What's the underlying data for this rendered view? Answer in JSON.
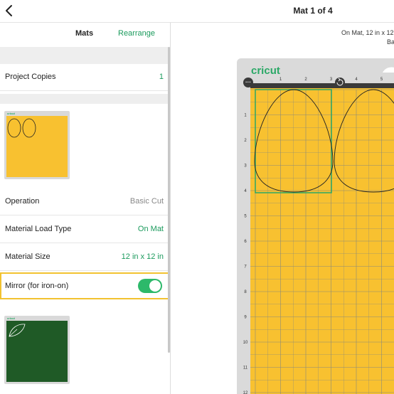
{
  "header": {
    "title": "Mat 1 of 4"
  },
  "left_panel": {
    "tabs": {
      "mats": "Mats",
      "rearrange": "Rearrange"
    },
    "project_copies": {
      "label": "Project Copies",
      "value": "1"
    },
    "operation": {
      "label": "Operation",
      "value": "Basic Cut"
    },
    "material_load_type": {
      "label": "Material Load Type",
      "value": "On Mat"
    },
    "material_size": {
      "label": "Material Size",
      "value": "12 in x 12 in"
    },
    "mirror": {
      "label": "Mirror (for iron-on)",
      "on": true
    },
    "thumb_logo": "cricut"
  },
  "canvas": {
    "info_line1": "On Mat, 12 in x 12",
    "info_line2": "Ba",
    "brand": "cricut",
    "top_ruler": [
      "1",
      "2",
      "3",
      "4",
      "5"
    ],
    "left_ruler": [
      "1",
      "2",
      "3",
      "4",
      "5",
      "6",
      "7",
      "8",
      "9",
      "10",
      "11",
      "12"
    ]
  },
  "colors": {
    "mat_yellow": "#f8c130",
    "mat_green": "#1f5a26",
    "accent_green": "#1a9a5c",
    "highlight": "#f2c230",
    "toggle_on": "#2db96a"
  }
}
